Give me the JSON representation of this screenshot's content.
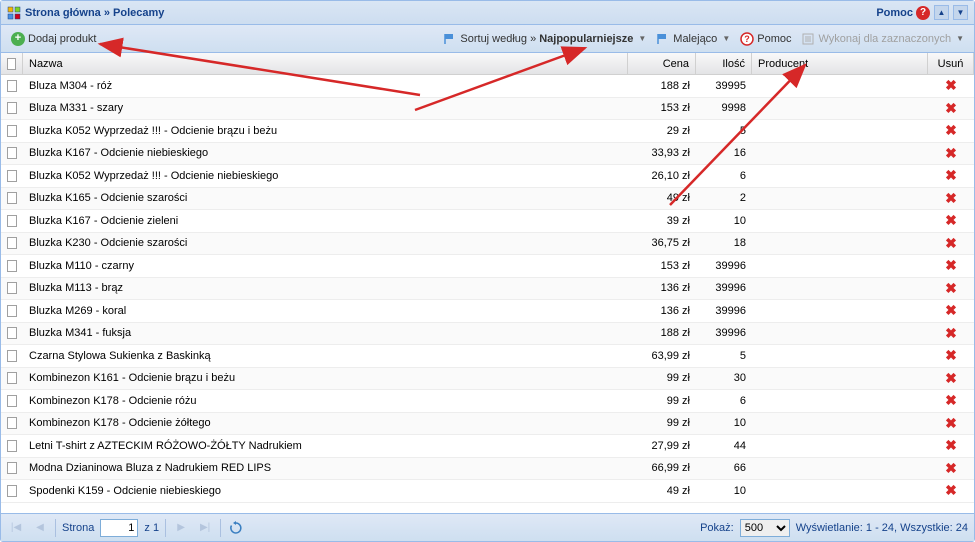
{
  "header": {
    "title": "Strona główna » Polecamy",
    "help_label": "Pomoc"
  },
  "toolbar": {
    "add_product": "Dodaj produkt",
    "sort_by_prefix": "Sortuj według »",
    "sort_by_value": "Najpopularniejsze",
    "direction": "Malejąco",
    "help": "Pomoc",
    "bulk_actions": "Wykonaj dla zaznaczonych"
  },
  "columns": {
    "name": "Nazwa",
    "price": "Cena",
    "qty": "Ilość",
    "producer": "Producent",
    "delete": "Usuń"
  },
  "rows": [
    {
      "name": "Bluza M304 - róż",
      "price": "188 zł",
      "qty": "39995",
      "producer": ""
    },
    {
      "name": "Bluza M331 - szary",
      "price": "153 zł",
      "qty": "9998",
      "producer": ""
    },
    {
      "name": "Bluzka K052 Wyprzedaż !!! - Odcienie brązu i beżu",
      "price": "29 zł",
      "qty": "5",
      "producer": ""
    },
    {
      "name": "Bluzka K167 - Odcienie niebieskiego",
      "price": "33,93 zł",
      "qty": "16",
      "producer": ""
    },
    {
      "name": "Bluzka K052 Wyprzedaż !!! - Odcienie niebieskiego",
      "price": "26,10 zł",
      "qty": "6",
      "producer": ""
    },
    {
      "name": "Bluzka K165 - Odcienie szarości",
      "price": "49 zł",
      "qty": "2",
      "producer": ""
    },
    {
      "name": "Bluzka K167 - Odcienie zieleni",
      "price": "39 zł",
      "qty": "10",
      "producer": ""
    },
    {
      "name": "Bluzka K230 - Odcienie szarości",
      "price": "36,75 zł",
      "qty": "18",
      "producer": ""
    },
    {
      "name": "Bluzka M110 - czarny",
      "price": "153 zł",
      "qty": "39996",
      "producer": ""
    },
    {
      "name": "Bluzka M113 - brąz",
      "price": "136 zł",
      "qty": "39996",
      "producer": ""
    },
    {
      "name": "Bluzka M269 - koral",
      "price": "136 zł",
      "qty": "39996",
      "producer": ""
    },
    {
      "name": "Bluzka M341 - fuksja",
      "price": "188 zł",
      "qty": "39996",
      "producer": ""
    },
    {
      "name": "Czarna Stylowa Sukienka z Baskinką",
      "price": "63,99 zł",
      "qty": "5",
      "producer": ""
    },
    {
      "name": "Kombinezon K161 - Odcienie brązu i beżu",
      "price": "99 zł",
      "qty": "30",
      "producer": ""
    },
    {
      "name": "Kombinezon K178 - Odcienie różu",
      "price": "99 zł",
      "qty": "6",
      "producer": ""
    },
    {
      "name": "Kombinezon K178 - Odcienie żółtego",
      "price": "99 zł",
      "qty": "10",
      "producer": ""
    },
    {
      "name": "Letni T-shirt z AZTECKIM RÓŻOWO-ŻÓŁTY Nadrukiem",
      "price": "27,99 zł",
      "qty": "44",
      "producer": ""
    },
    {
      "name": "Modna Dzianinowa Bluza z Nadrukiem RED LIPS",
      "price": "66,99 zł",
      "qty": "66",
      "producer": ""
    },
    {
      "name": "Spodenki K159 - Odcienie niebieskiego",
      "price": "49 zł",
      "qty": "10",
      "producer": ""
    }
  ],
  "paging": {
    "page_label": "Strona",
    "page_value": "1",
    "of_label": "z 1",
    "show_label": "Pokaż:",
    "page_size": "500",
    "display_info": "Wyświetlanie: 1 - 24, Wszystkie: 24"
  }
}
